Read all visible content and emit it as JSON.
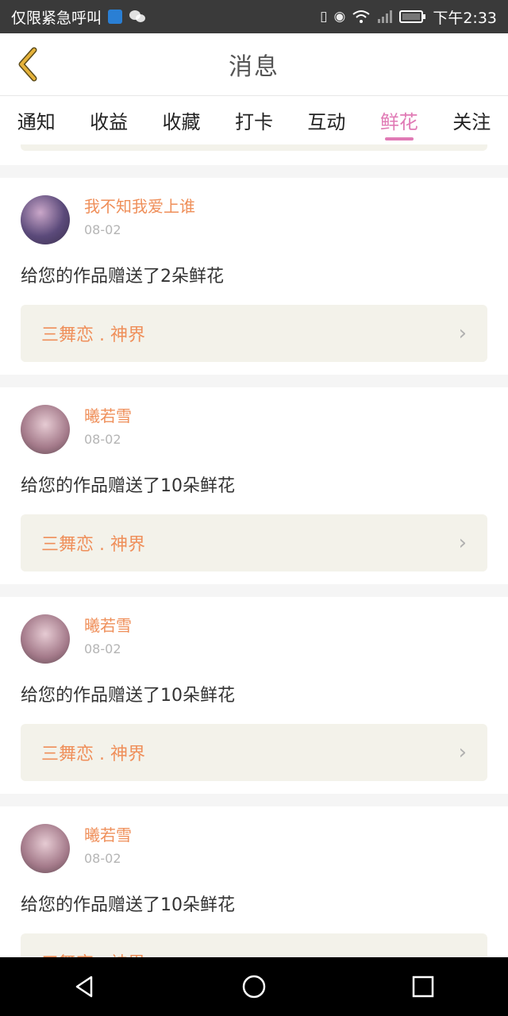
{
  "status_bar": {
    "carrier": "仅限紧急呼叫",
    "time": "下午2:33"
  },
  "header": {
    "title": "消息"
  },
  "tabs": [
    {
      "label": "通知"
    },
    {
      "label": "收益"
    },
    {
      "label": "收藏"
    },
    {
      "label": "打卡"
    },
    {
      "label": "互动"
    },
    {
      "label": "鲜花"
    },
    {
      "label": "关注"
    }
  ],
  "active_tab": "鲜花",
  "messages": [
    {
      "user": "我不知我爱上谁",
      "date": "08-02",
      "text": "给您的作品赠送了2朵鲜花",
      "work": "三舞恋 . 神界"
    },
    {
      "user": "曦若雪",
      "date": "08-02",
      "text": "给您的作品赠送了10朵鲜花",
      "work": "三舞恋 . 神界"
    },
    {
      "user": "曦若雪",
      "date": "08-02",
      "text": "给您的作品赠送了10朵鲜花",
      "work": "三舞恋 . 神界"
    },
    {
      "user": "曦若雪",
      "date": "08-02",
      "text": "给您的作品赠送了10朵鲜花",
      "work": "三舞恋 . 神界"
    }
  ],
  "colors": {
    "accent_pink": "#e07ab5",
    "accent_orange": "#ef8f5a",
    "back_icon": "#e5b23a"
  },
  "icons": {
    "back": "chevron-left-icon",
    "nav_back": "triangle-back-icon",
    "nav_home": "circle-home-icon",
    "nav_recent": "square-recent-icon"
  }
}
